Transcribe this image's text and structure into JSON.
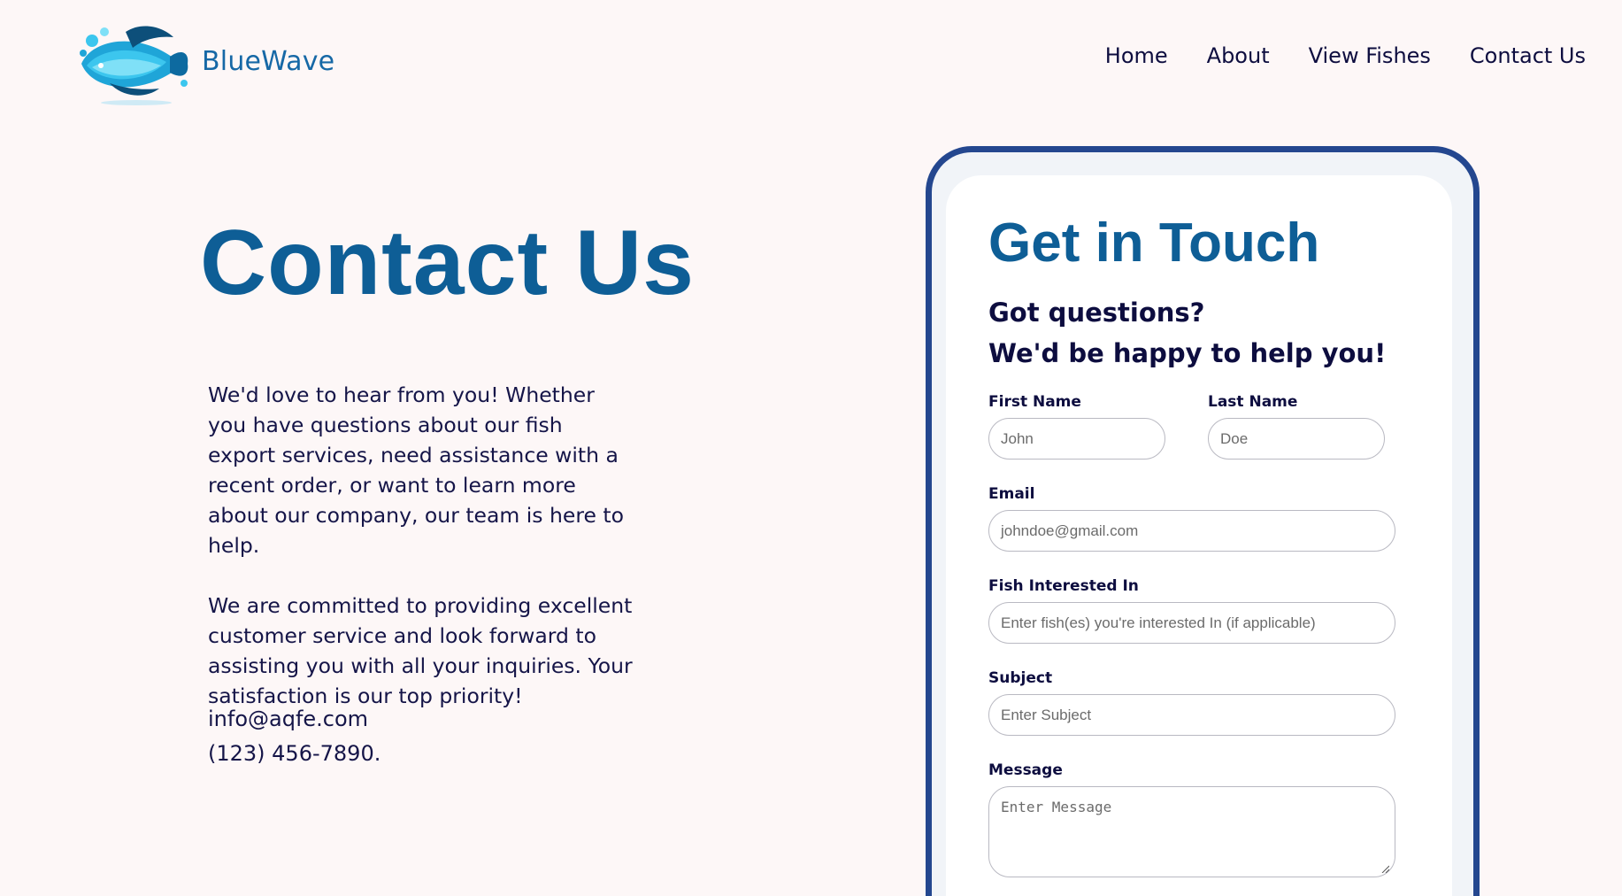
{
  "header": {
    "brand": "BlueWave",
    "nav": [
      "Home",
      "About",
      "View Fishes",
      "Contact Us"
    ]
  },
  "hero": {
    "title": "Contact Us",
    "paragraphs": [
      "We'd love to hear from you! Whether you have questions about our fish export services, need assistance with a recent order, or want to learn more about our company, our team is here to help.",
      "We are committed to providing excellent customer service and look forward to assisting you with all your inquiries. Your satisfaction is our top priority!"
    ],
    "email": "info@aqfe.com",
    "phone": "(123) 456-7890."
  },
  "form": {
    "title": "Get in Touch",
    "subtitle_line1": "Got questions?",
    "subtitle_line2": "We'd be happy to help you!",
    "first_name": {
      "label": "First Name",
      "placeholder": "John"
    },
    "last_name": {
      "label": "Last Name",
      "placeholder": "Doe"
    },
    "email": {
      "label": "Email",
      "placeholder": "johndoe@gmail.com"
    },
    "fish": {
      "label": "Fish Interested In",
      "placeholder": "Enter fish(es) you're interested In (if applicable)"
    },
    "subject": {
      "label": "Subject",
      "placeholder": "Enter Subject"
    },
    "message": {
      "label": "Message",
      "placeholder": "Enter Message"
    }
  },
  "colors": {
    "background": "#fdf7f7",
    "brand_blue": "#0e5e96",
    "phone_border": "#24478f",
    "text_dark": "#0d0d3f"
  }
}
